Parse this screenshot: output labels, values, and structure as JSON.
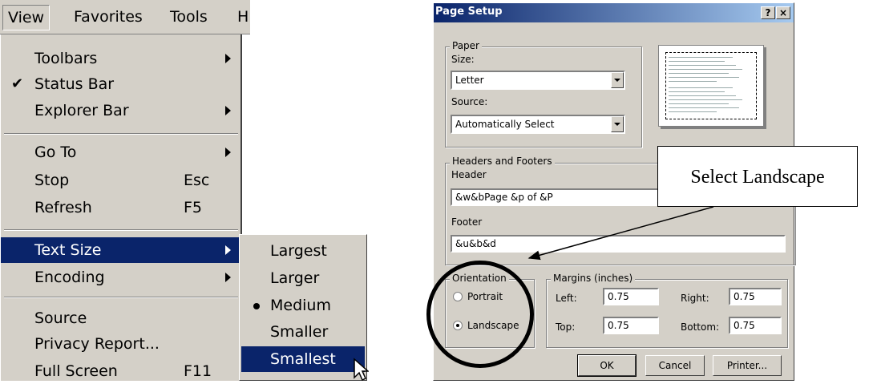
{
  "menubar": {
    "items": [
      "View",
      "Favorites",
      "Tools",
      "H"
    ]
  },
  "view_menu": {
    "items": [
      {
        "label": "Toolbars",
        "submenu": true
      },
      {
        "label": "Status Bar",
        "checked": true
      },
      {
        "label": "Explorer Bar",
        "submenu": true
      },
      {
        "label": "Go To",
        "submenu": true
      },
      {
        "label": "Stop",
        "shortcut": "Esc"
      },
      {
        "label": "Refresh",
        "shortcut": "F5"
      },
      {
        "label": "Text Size",
        "submenu": true,
        "highlighted": true
      },
      {
        "label": "Encoding",
        "submenu": true
      },
      {
        "label": "Source"
      },
      {
        "label": "Privacy Report..."
      },
      {
        "label": "Full Screen",
        "shortcut": "F11"
      }
    ]
  },
  "text_size_menu": {
    "items": [
      "Largest",
      "Larger",
      "Medium",
      "Smaller",
      "Smallest"
    ],
    "selected": "Medium",
    "highlighted": "Smallest"
  },
  "dialog": {
    "title": "Page Setup",
    "help_button": "?",
    "close_button": "×",
    "paper": {
      "group": "Paper",
      "size_label": "Size:",
      "size_value": "Letter",
      "source_label": "Source:",
      "source_value": "Automatically Select"
    },
    "headers": {
      "group": "Headers and Footers",
      "header_label": "Header",
      "header_value": "&w&bPage &p of &P",
      "footer_label": "Footer",
      "footer_value": "&u&b&d"
    },
    "orientation": {
      "group": "Orientation",
      "portrait": "Portrait",
      "landscape": "Landscape",
      "selected": "Landscape"
    },
    "margins": {
      "group": "Margins (inches)",
      "left_label": "Left:",
      "left_value": "0.75",
      "right_label": "Right:",
      "right_value": "0.75",
      "top_label": "Top:",
      "top_value": "0.75",
      "bottom_label": "Bottom:",
      "bottom_value": "0.75"
    },
    "buttons": {
      "ok": "OK",
      "cancel": "Cancel",
      "printer": "Printer..."
    }
  },
  "annotation": {
    "callout": "Select Landscape"
  },
  "colors": {
    "menu_bg": "#d4d0c8",
    "highlight": "#0a246a",
    "title_start": "#0a246a",
    "title_end": "#a6caf0"
  }
}
